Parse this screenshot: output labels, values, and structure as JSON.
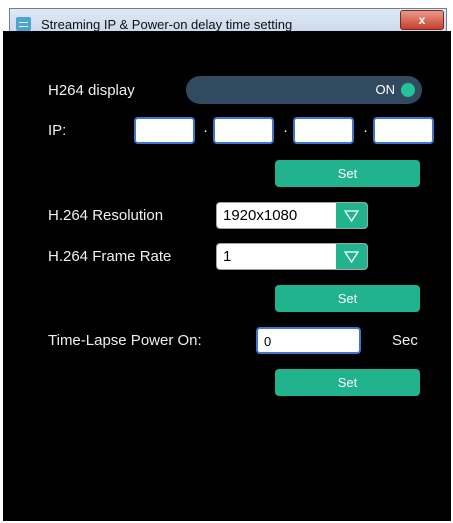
{
  "window": {
    "title": "Streaming IP & Power-on delay time setting",
    "close_label": "x"
  },
  "h264_display": {
    "label": "H264 display",
    "state": "ON"
  },
  "ip": {
    "label": "IP:",
    "separator": "·",
    "octets": [
      "",
      "",
      "",
      ""
    ],
    "set_label": "Set"
  },
  "resolution": {
    "label": "H.264 Resolution",
    "value": "1920x1080"
  },
  "frame_rate": {
    "label": "H.264 Frame Rate",
    "value": "1",
    "set_label": "Set"
  },
  "time_lapse": {
    "label": "Time-Lapse Power On:",
    "value": "0",
    "unit": "Sec",
    "set_label": "Set"
  },
  "colors": {
    "accent": "#21b28e",
    "background": "#000000",
    "toggle_track": "#324a60",
    "input_border": "#3f77c8"
  },
  "icons": [
    "app-icon",
    "close-icon",
    "chevron-down-icon"
  ]
}
